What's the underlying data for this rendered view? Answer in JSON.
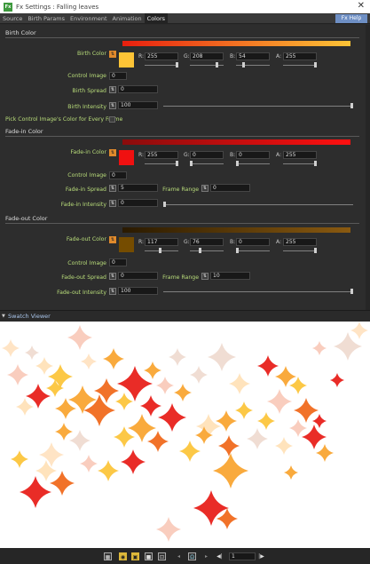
{
  "window": {
    "title": "Fx Settings : Falling leaves",
    "icon_text": "Fx",
    "close": "✕"
  },
  "tabs": [
    "Source",
    "Birth Params",
    "Environment",
    "Animation",
    "Colors"
  ],
  "active_tab": "Colors",
  "help_label": "Fx Help",
  "sections": {
    "birth": "Birth Color",
    "fadein": "Fade-in Color",
    "fadeout": "Fade-out Color"
  },
  "birth": {
    "color_label": "Birth Color",
    "swatch": "#fdc436",
    "gradient": [
      "#e81f0e",
      "#fdc436"
    ],
    "r": {
      "label": "R:",
      "value": "255",
      "level": 1.0
    },
    "g": {
      "label": "G:",
      "value": "208",
      "level": 0.816
    },
    "b": {
      "label": "B:",
      "value": "54",
      "level": 0.212
    },
    "a": {
      "label": "A:",
      "value": "255",
      "level": 1.0
    },
    "control_label": "Control Image",
    "control_value": "0",
    "spread_label": "Birth Spread",
    "spread_value": "0",
    "intensity_label": "Birth Intensity",
    "intensity_value": "100",
    "intensity_level": 1.0,
    "pick_label": "Pick Control Image's Color for Every Frame"
  },
  "fadein": {
    "color_label": "Fade-in Color",
    "swatch": "#f01010",
    "gradient": [
      "#8a0c0c",
      "#ff1010"
    ],
    "r": {
      "label": "R:",
      "value": "255",
      "level": 1.0
    },
    "g": {
      "label": "G:",
      "value": "0",
      "level": 0.0
    },
    "b": {
      "label": "B:",
      "value": "0",
      "level": 0.0
    },
    "a": {
      "label": "A:",
      "value": "255",
      "level": 1.0
    },
    "control_label": "Control Image",
    "control_value": "0",
    "spread_label": "Fade-in Spread",
    "spread_value": "5",
    "frame_label": "Frame Range",
    "frame_value": "0",
    "intensity_label": "Fade-in Intensity",
    "intensity_value": "0",
    "intensity_level": 0.0
  },
  "fadeout": {
    "color_label": "Fade-out Color",
    "swatch": "#754c00",
    "gradient": [
      "#2a1a00",
      "#8a5a10"
    ],
    "r": {
      "label": "R:",
      "value": "117",
      "level": 0.459
    },
    "g": {
      "label": "G:",
      "value": "76",
      "level": 0.298
    },
    "b": {
      "label": "B:",
      "value": "0",
      "level": 0.0
    },
    "a": {
      "label": "A:",
      "value": "255",
      "level": 1.0
    },
    "control_label": "Control Image",
    "control_value": "0",
    "spread_label": "Fade-out Spread",
    "spread_value": "0",
    "frame_label": "Frame Range",
    "frame_value": "10",
    "intensity_label": "Fade-out Intensity",
    "intensity_value": "100",
    "intensity_level": 1.0
  },
  "param_icon": "⇅",
  "swatch_viewer": {
    "label": "Swatch Viewer"
  },
  "viewer_bar": {
    "frame": "1"
  },
  "sparkle_colors": [
    "#e8211b",
    "#f06a1e",
    "#f9a533",
    "#fcc53c",
    "#ffe2b8",
    "#f7b8a2",
    "#e9cfc0",
    "#ffd9ac"
  ]
}
